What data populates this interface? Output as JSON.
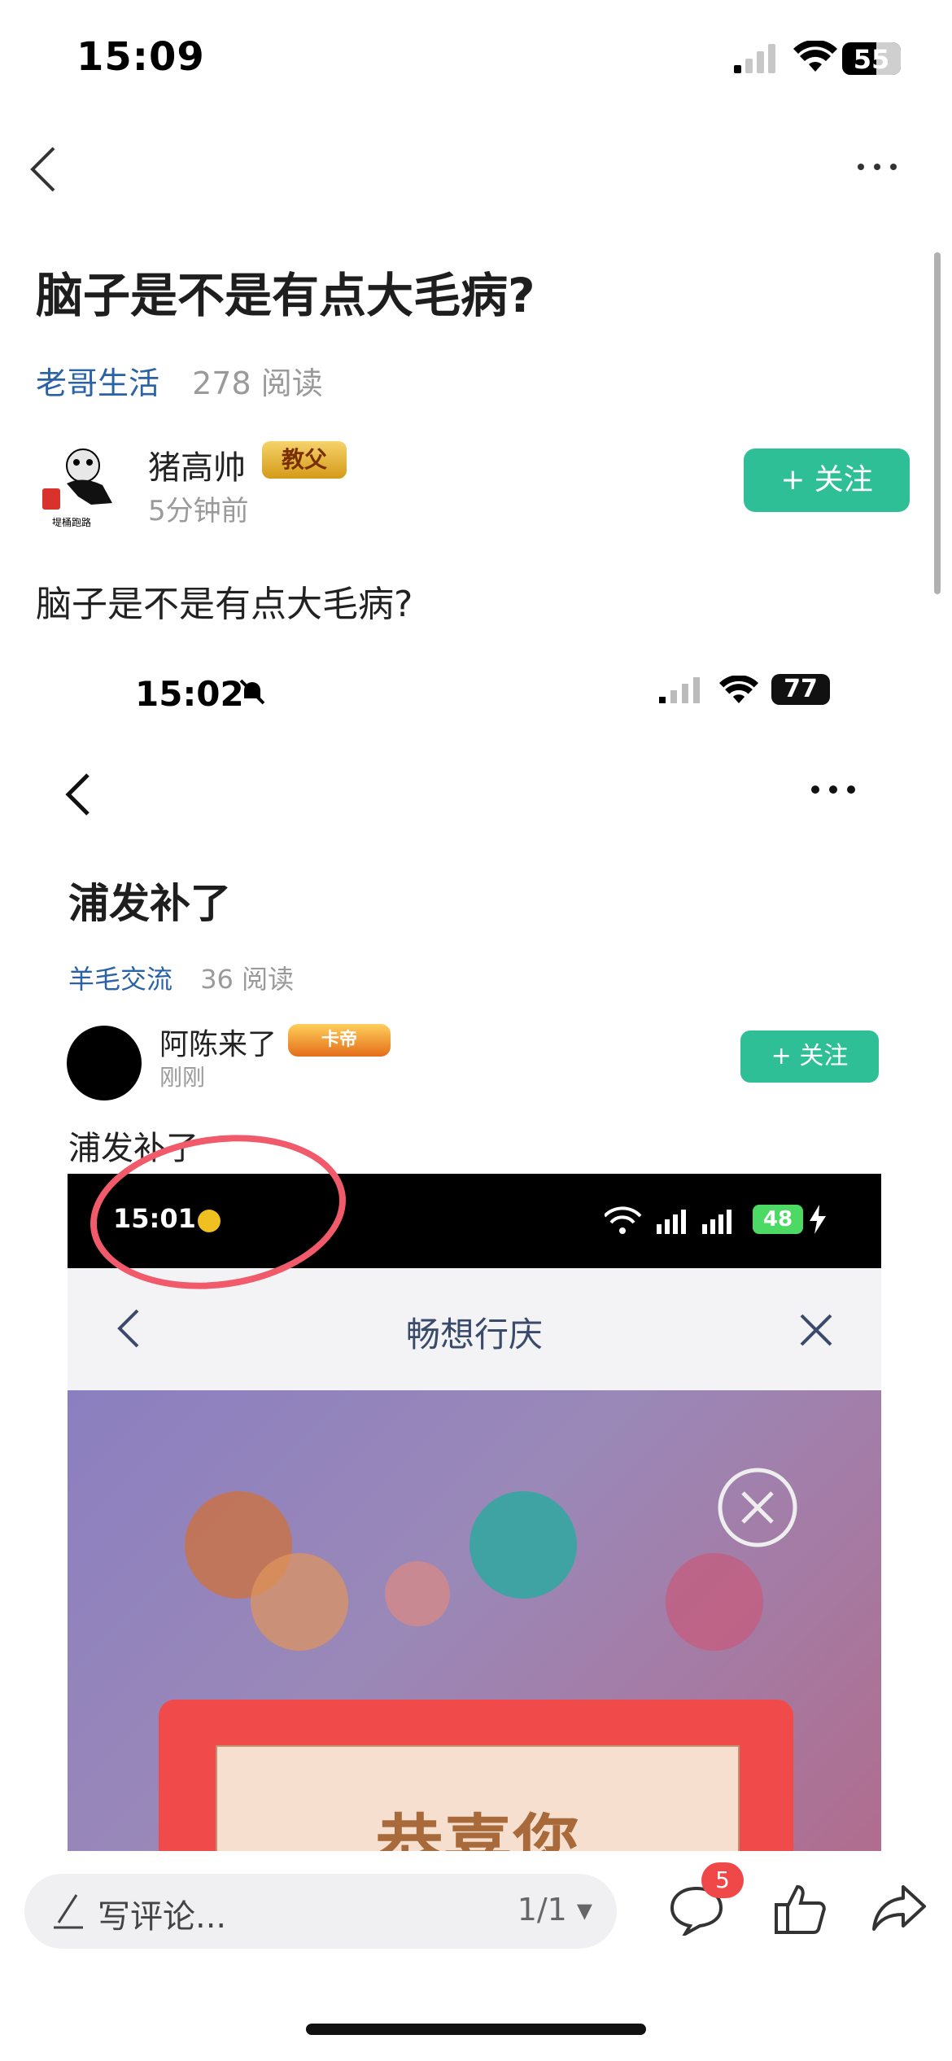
{
  "status_bar": {
    "time": "15:09",
    "battery": "55"
  },
  "post": {
    "title": "脑子是不是有点大毛病?",
    "category": "老哥生活",
    "reads": "278 阅读",
    "author": {
      "name": "猪高帅",
      "badge": "教父",
      "time": "5分钟前"
    },
    "follow_label": "+ 关注",
    "body": "脑子是不是有点大毛病?"
  },
  "embedded": {
    "status_time": "15:02",
    "battery": "77",
    "title": "浦发补了",
    "category": "羊毛交流",
    "reads": "36 阅读",
    "author": {
      "name": "阿陈来了",
      "badge": "卡帝",
      "time": "刚刚"
    },
    "follow_label": "+ 关注",
    "body": "浦发补了",
    "inner": {
      "status_time": "15:01",
      "battery": "48",
      "nav_title": "畅想行庆",
      "card_text": "恭喜您"
    }
  },
  "bottom_bar": {
    "comment_placeholder": "写评论...",
    "page_indicator": "1/1",
    "comment_count": "5"
  },
  "colors": {
    "accent": "#2fbf97",
    "link": "#2a62a8",
    "badge_red": "#f04848"
  }
}
